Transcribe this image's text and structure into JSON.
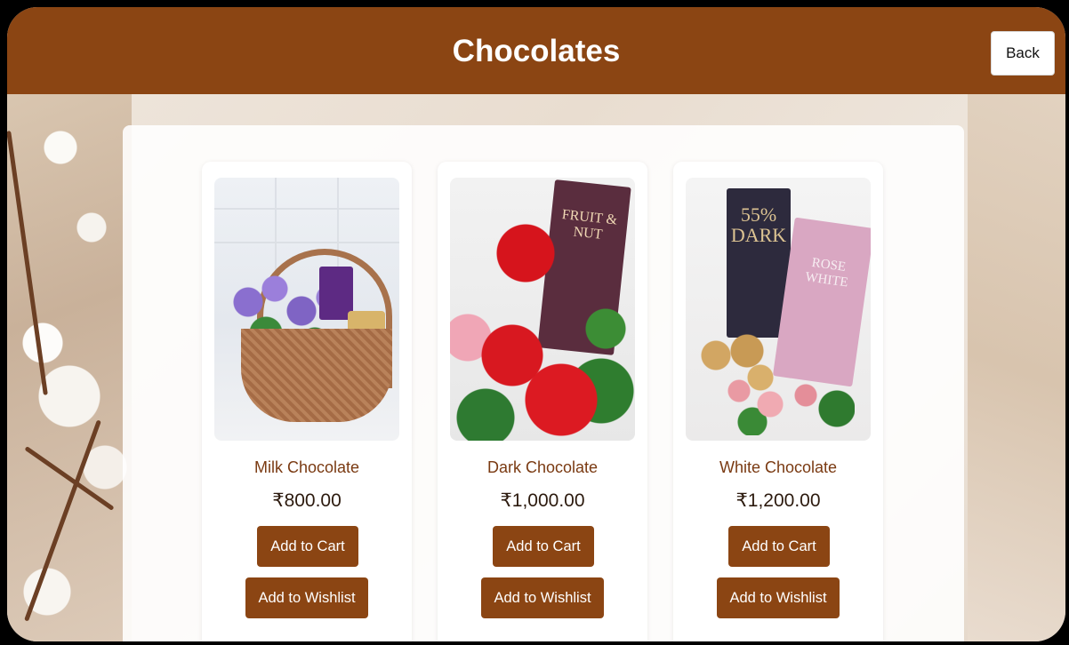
{
  "header": {
    "title": "Chocolates",
    "back_label": "Back"
  },
  "products": [
    {
      "name": "Milk Chocolate",
      "price": "₹800.00",
      "add_to_cart_label": "Add to Cart",
      "add_to_wishlist_label": "Add to Wishlist",
      "image_icon": "chocolate-basket-image"
    },
    {
      "name": "Dark Chocolate",
      "price": "₹1,000.00",
      "add_to_cart_label": "Add to Cart",
      "add_to_wishlist_label": "Add to Wishlist",
      "image_icon": "roses-dark-chocolate-image",
      "package_text": "FRUIT & NUT"
    },
    {
      "name": "White Chocolate",
      "price": "₹1,200.00",
      "add_to_cart_label": "Add to Cart",
      "add_to_wishlist_label": "Add to Wishlist",
      "image_icon": "dark-white-chocolate-image",
      "package_text_dark": "55% DARK",
      "package_text_white": "ROSE WHITE"
    }
  ],
  "colors": {
    "header_bg": "#8b4513",
    "button_bg": "#8b4513",
    "name_text": "#7a3a12"
  }
}
